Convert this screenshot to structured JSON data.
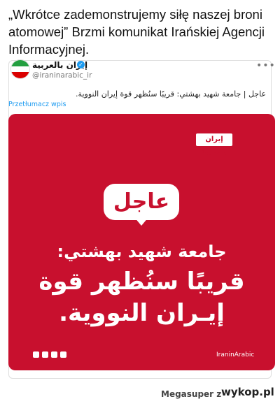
{
  "headline": "„Wkrótce zademonstrujemy siłę naszej broni atomowej” Brzmi komunikat Irańskiej Agencji Informacyjnej.",
  "tweet": {
    "account_name": "إيران بالعربية",
    "handle": "@iraninarabic_ir",
    "more_icon": "•••",
    "text": "عاجل | جامعة شهيد بهشتي: قريبًا سنُظهر قوة إيران النووية.",
    "translate_link": "Przetłumacz wpis"
  },
  "media": {
    "logo_text": "إيران بالعربية",
    "badge": "عاجل",
    "line1": "جامعة شهيد بهشتي:",
    "line2": "قريبًا سنُظهر قوة",
    "line3": "إيـران النووية.",
    "brand": "IraninArabic"
  },
  "footer": {
    "user": "Megasuper",
    "z": "z",
    "site": "wykop.pl"
  }
}
